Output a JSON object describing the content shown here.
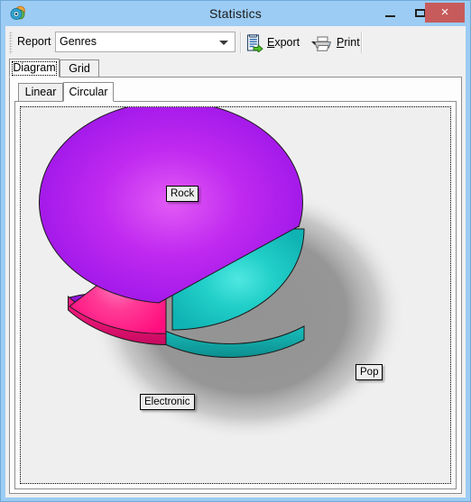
{
  "window": {
    "title": "Statistics",
    "app_icon": "disc-logo-icon",
    "controls": {
      "minimize": "minimize-icon",
      "maximize": "maximize-icon",
      "close": "×",
      "close_color": "#C75B5B"
    },
    "titlebar_color": "#9CCCF4"
  },
  "toolbar": {
    "report_label": "Report",
    "report_combo": {
      "value": "Genres",
      "placeholder": "Genres",
      "options": [
        "Genres"
      ]
    },
    "export": {
      "label": "Export",
      "accel": "E",
      "icon": "export-clipboard-icon",
      "has_dropdown": true
    },
    "print": {
      "label": "Print",
      "accel": "P",
      "icon": "printer-icon"
    }
  },
  "tabs": {
    "outer": [
      {
        "label": "Diagram",
        "selected": true
      },
      {
        "label": "Grid",
        "selected": false
      }
    ],
    "inner": [
      {
        "label": "Linear",
        "selected": false
      },
      {
        "label": "Circular",
        "selected": true
      }
    ]
  },
  "chart_data": {
    "type": "pie",
    "title": "",
    "style": "3d-exploded-pie",
    "background": "#EFEFEF",
    "legend": "none",
    "labels_position": "callout-boxes",
    "categories": [
      "Rock",
      "Electronic",
      "Pop"
    ],
    "values": [
      62,
      13,
      25
    ],
    "unit": "percent",
    "start_angle_deg": 0,
    "direction": "clockwise",
    "slices": [
      {
        "name": "Rock",
        "value": 62,
        "percent": "62%",
        "color": "#9B14E8",
        "highlight_color": "#E25BF5",
        "start_angle_deg": 0,
        "end_angle_deg": 223,
        "label": "Rock"
      },
      {
        "name": "Electronic",
        "value": 13,
        "percent": "13%",
        "color": "#FF1E86",
        "highlight_color": "#FF7FC0",
        "start_angle_deg": 223,
        "end_angle_deg": 270,
        "label": "Electronic"
      },
      {
        "name": "Pop",
        "value": 25,
        "percent": "25%",
        "color": "#17BDBD",
        "highlight_color": "#4FE8E0",
        "start_angle_deg": 270,
        "end_angle_deg": 360,
        "label": "Pop"
      }
    ]
  }
}
